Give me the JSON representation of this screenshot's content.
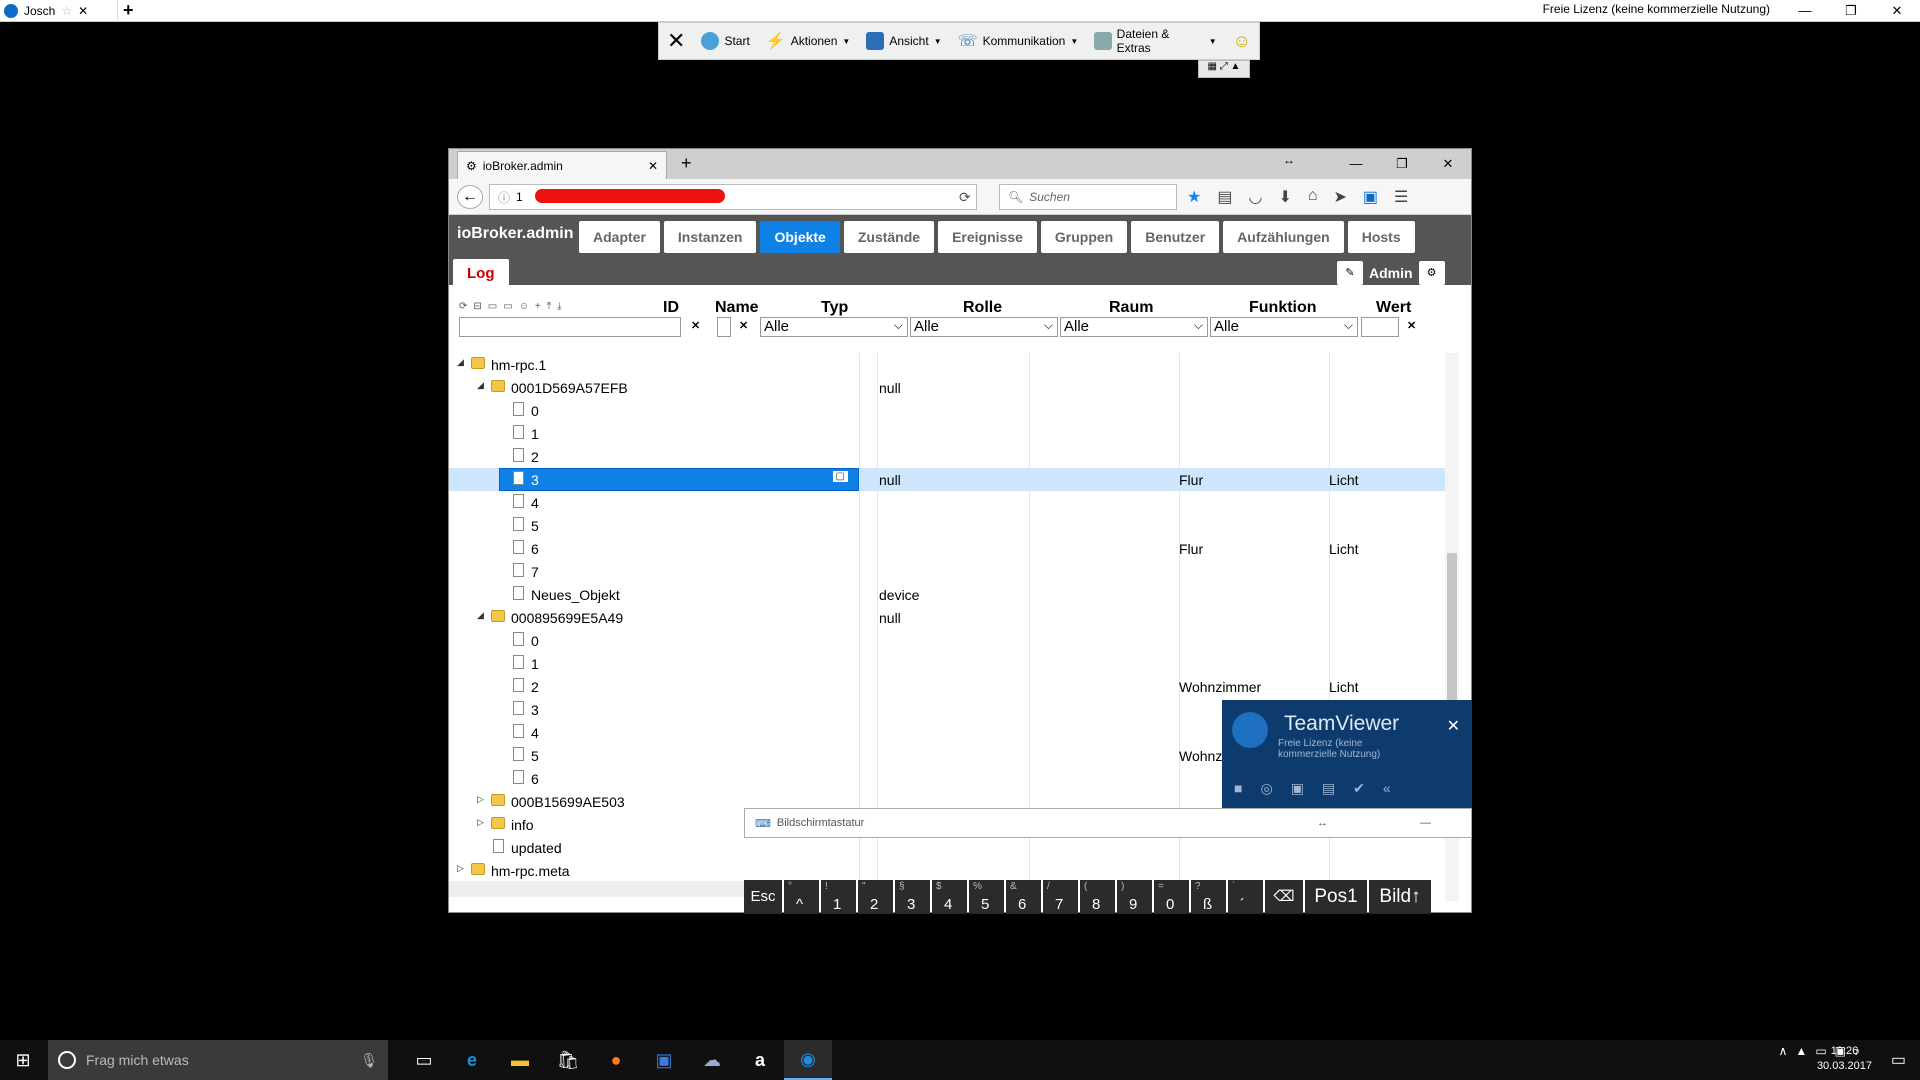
{
  "tv": {
    "tab_title": "Josch",
    "license": "Freie Lizenz (keine kommerzielle Nutzung)",
    "toolbar": [
      {
        "label": "Start",
        "icon": "start-icon"
      },
      {
        "label": "Aktionen",
        "icon": "lightning-icon"
      },
      {
        "label": "Ansicht",
        "icon": "monitor-icon"
      },
      {
        "label": "Kommunikation",
        "icon": "phone-icon"
      },
      {
        "label": "Dateien & Extras",
        "icon": "files-icon"
      }
    ]
  },
  "browser": {
    "tab_title": "ioBroker.admin",
    "url": "1",
    "search_placeholder": "Suchen"
  },
  "io": {
    "brand": "ioBroker.admin",
    "tabs": [
      "Adapter",
      "Instanzen",
      "Objekte",
      "Zustände",
      "Ereignisse",
      "Gruppen",
      "Benutzer",
      "Aufzählungen",
      "Hosts"
    ],
    "active_tab": "Objekte",
    "log": "Log",
    "admin": "Admin",
    "columns": {
      "id": "ID",
      "name": "Name",
      "type": "Typ",
      "role": "Rolle",
      "room": "Raum",
      "function": "Funktion",
      "value": "Wert"
    },
    "filters": {
      "type": "Alle",
      "role": "Alle",
      "room": "Alle",
      "function": "Alle"
    }
  },
  "tree": [
    {
      "name": "hm-rpc.1",
      "level": 0,
      "kind": "folder",
      "open": true,
      "type": "",
      "room": "",
      "fn": ""
    },
    {
      "name": "0001D569A57EFB",
      "level": 1,
      "kind": "folder",
      "open": true,
      "type": "null",
      "room": "",
      "fn": ""
    },
    {
      "name": "0",
      "level": 2,
      "kind": "file",
      "type": "",
      "room": "",
      "fn": ""
    },
    {
      "name": "1",
      "level": 2,
      "kind": "file",
      "type": "",
      "room": "",
      "fn": ""
    },
    {
      "name": "2",
      "level": 2,
      "kind": "file",
      "type": "",
      "room": "",
      "fn": ""
    },
    {
      "name": "3",
      "level": 2,
      "kind": "file",
      "type": "null",
      "room": "Flur",
      "fn": "Licht",
      "selected": true
    },
    {
      "name": "4",
      "level": 2,
      "kind": "file",
      "type": "",
      "room": "",
      "fn": ""
    },
    {
      "name": "5",
      "level": 2,
      "kind": "file",
      "type": "",
      "room": "",
      "fn": ""
    },
    {
      "name": "6",
      "level": 2,
      "kind": "file",
      "type": "",
      "room": "Flur",
      "fn": "Licht"
    },
    {
      "name": "7",
      "level": 2,
      "kind": "file",
      "type": "",
      "room": "",
      "fn": ""
    },
    {
      "name": "Neues_Objekt",
      "level": 2,
      "kind": "file",
      "type": "device",
      "room": "",
      "fn": ""
    },
    {
      "name": "000895699E5A49",
      "level": 1,
      "kind": "folder",
      "open": true,
      "type": "null",
      "room": "",
      "fn": ""
    },
    {
      "name": "0",
      "level": 2,
      "kind": "file",
      "type": "",
      "room": "",
      "fn": ""
    },
    {
      "name": "1",
      "level": 2,
      "kind": "file",
      "type": "",
      "room": "",
      "fn": ""
    },
    {
      "name": "2",
      "level": 2,
      "kind": "file",
      "type": "",
      "room": "Wohnzimmer",
      "fn": "Licht"
    },
    {
      "name": "3",
      "level": 2,
      "kind": "file",
      "type": "",
      "room": "",
      "fn": ""
    },
    {
      "name": "4",
      "level": 2,
      "kind": "file",
      "type": "",
      "room": "",
      "fn": ""
    },
    {
      "name": "5",
      "level": 2,
      "kind": "file",
      "type": "",
      "room": "Wohnz",
      "fn": ""
    },
    {
      "name": "6",
      "level": 2,
      "kind": "file",
      "type": "",
      "room": "",
      "fn": ""
    },
    {
      "name": "000B15699AE503",
      "level": 1,
      "kind": "folder",
      "open": false,
      "type": "",
      "room": "",
      "fn": ""
    },
    {
      "name": "info",
      "level": 1,
      "kind": "folder",
      "open": false,
      "type": "",
      "room": "",
      "fn": ""
    },
    {
      "name": "updated",
      "level": 1,
      "kind": "file",
      "type": "",
      "room": "",
      "fn": ""
    },
    {
      "name": "hm-rpc.meta",
      "level": 0,
      "kind": "folder",
      "open": false,
      "type": "",
      "room": "",
      "fn": ""
    }
  ],
  "teamviewer_panel": {
    "name": "TeamViewer",
    "sub": "Freie Lizenz (keine kommerzielle Nutzung)"
  },
  "osk": {
    "title": "Bildschirmtastatur",
    "keys": [
      {
        "t": "Esc"
      },
      {
        "a": "°",
        "b": "^"
      },
      {
        "a": "!",
        "b": "1"
      },
      {
        "a": "\"",
        "b": "2"
      },
      {
        "a": "§",
        "b": "3"
      },
      {
        "a": "$",
        "b": "4"
      },
      {
        "a": "%",
        "b": "5"
      },
      {
        "a": "&",
        "b": "6"
      },
      {
        "a": "/",
        "b": "7"
      },
      {
        "a": "(",
        "b": "8"
      },
      {
        "a": ")",
        "b": "9"
      },
      {
        "a": "=",
        "b": "0"
      },
      {
        "a": "?",
        "b": "ß"
      },
      {
        "a": "`",
        "b": "´"
      },
      {
        "t": "⌫"
      },
      {
        "t": "Pos1"
      },
      {
        "t": "Bild↑"
      }
    ]
  },
  "taskbar": {
    "search": "Frag mich etwas",
    "time": "19:26",
    "date": "30.03.2017"
  }
}
